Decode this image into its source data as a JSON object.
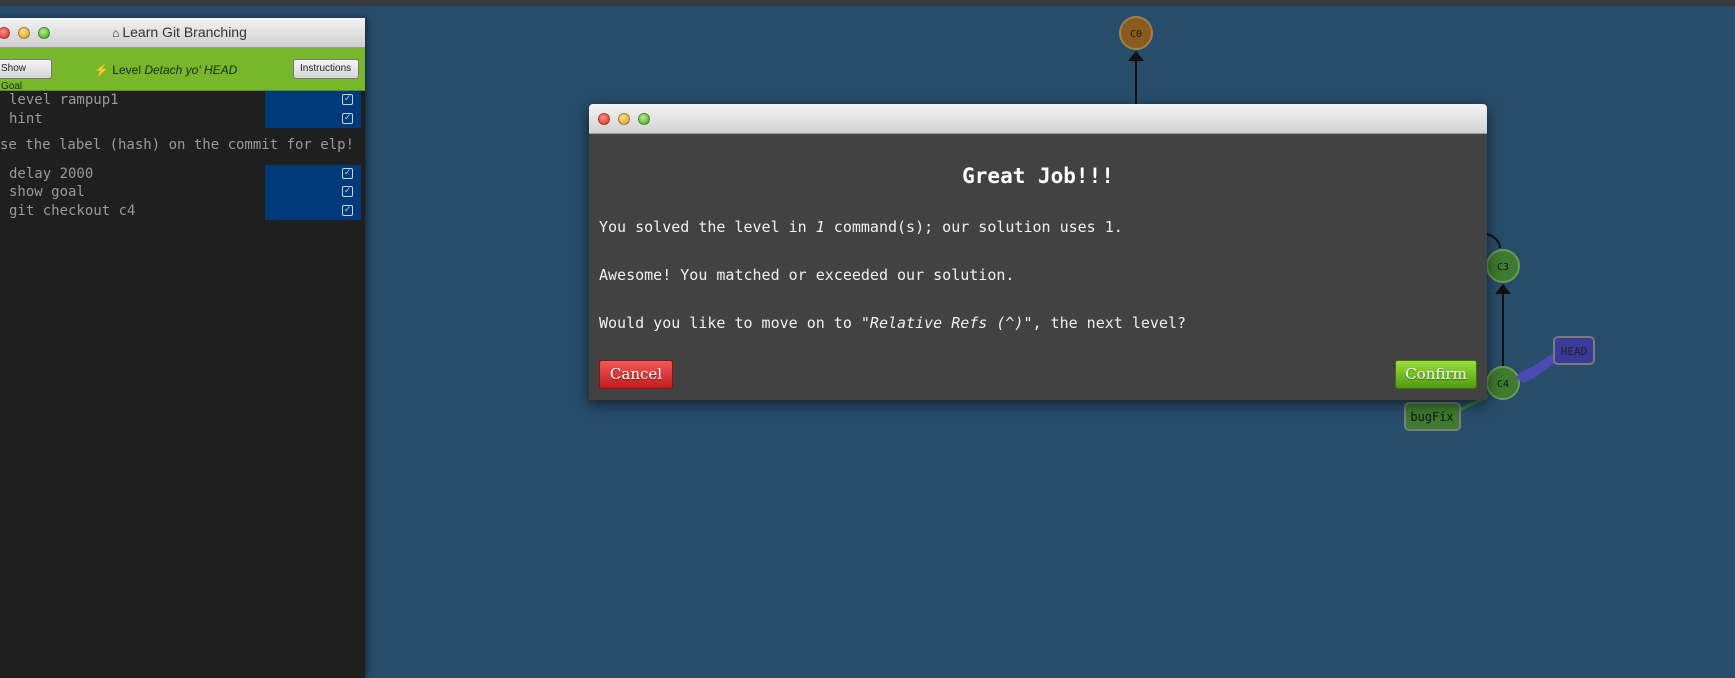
{
  "panel": {
    "title": "Learn Git Branching",
    "show_goal_label": "Show Goal",
    "instructions_label": "Instructions",
    "level_prefix": "Level",
    "level_name": "Detach yo' HEAD",
    "commands_top": [
      "level rampup1",
      "hint"
    ],
    "hint_message": "se the label (hash) on the commit for elp!",
    "commands_bottom": [
      "delay 2000",
      "show goal",
      "git checkout c4"
    ]
  },
  "tree": {
    "commits": [
      "C0",
      "C3",
      "C4"
    ],
    "branches": [
      "bugFix"
    ],
    "head_label": "HEAD",
    "colors": {
      "c0": "#8a5a1e",
      "commit_green": "#3e7a2f",
      "branch_fill": "#3e7a2f",
      "head_fill": "#3a3a9a"
    }
  },
  "modal": {
    "heading": "Great Job!!!",
    "line1_pre": "You solved the level in ",
    "line1_count": "1",
    "line1_post": " command(s); our solution uses 1.",
    "line2": "Awesome! You matched or exceeded our solution.",
    "line3_pre": "Would you like to move on to ",
    "line3_level": "\"Relative Refs (^)\"",
    "line3_post": ", the next level?",
    "cancel_label": "Cancel",
    "confirm_label": "Confirm"
  }
}
